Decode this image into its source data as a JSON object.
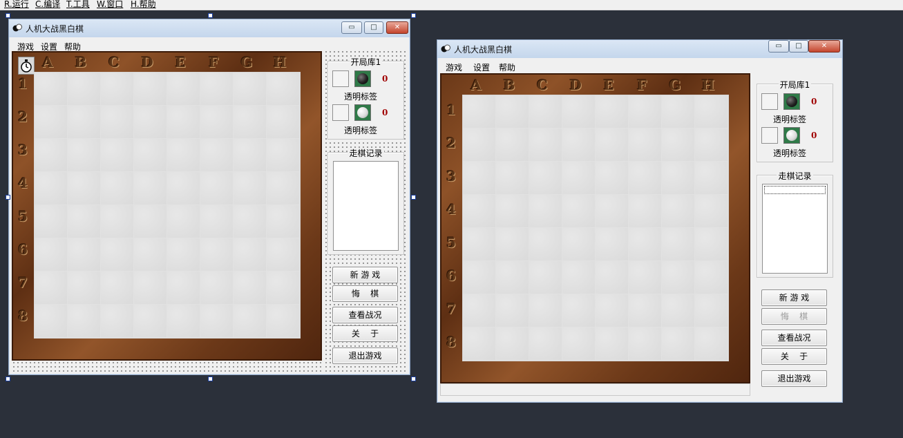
{
  "ide_menu": [
    {
      "label": "R.运行"
    },
    {
      "label": "C.编译"
    },
    {
      "label": "T.工具"
    },
    {
      "label": "W.窗口"
    },
    {
      "label": "H.帮助"
    }
  ],
  "app": {
    "title": "人机大战黑白棋",
    "caption_buttons": {
      "minimize": "▭",
      "maximize": "□",
      "close": "✕"
    },
    "menu": [
      "游戏",
      "设置",
      "帮助"
    ],
    "columns": [
      "A",
      "B",
      "C",
      "D",
      "E",
      "F",
      "G",
      "H"
    ],
    "rows": [
      "1",
      "2",
      "3",
      "4",
      "5",
      "6",
      "7",
      "8"
    ],
    "opening_group_title": "开局库1",
    "black_count": "0",
    "white_count": "0",
    "transparent_label": "透明标签",
    "moves_group_title": "走棋记录",
    "buttons": {
      "new_game": "新 游 戏",
      "undo": "悔    棋",
      "view_status": "查看战况",
      "about": "关    于",
      "exit": "退出游戏"
    },
    "undo_disabled_in_runtime": true
  },
  "colors": {
    "felt": "#2f7a48",
    "wood": "#7a4420",
    "count_red": "#a00000",
    "ide_background": "#2b303a"
  }
}
